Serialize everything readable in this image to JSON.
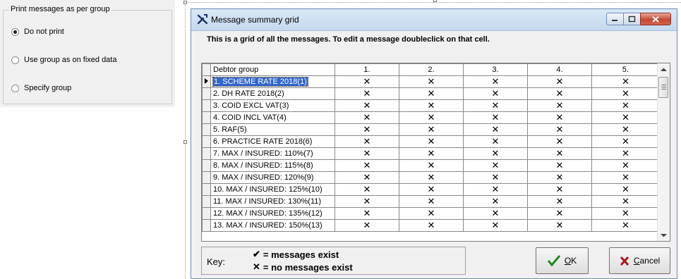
{
  "group_box": {
    "legend": "Print messages as per group",
    "options": [
      {
        "label": "Do not print",
        "checked": true
      },
      {
        "label": "Use group as on fixed data",
        "checked": false
      },
      {
        "label": "Specify group",
        "checked": false
      }
    ]
  },
  "dialog": {
    "title": "Message summary grid",
    "instruction": "This is a grid of all the messages.  To edit a message doubleclick on that cell.",
    "grid": {
      "header_first": "Debtor group",
      "columns": [
        "1.",
        "2.",
        "3.",
        "4.",
        "5."
      ],
      "no_message_symbol": "✕",
      "rows": [
        "1. SCHEME RATE 2018(1)",
        "2. DH RATE 2018(2)",
        "3. COID EXCL VAT(3)",
        "4. COID INCL VAT(4)",
        "5. RAF(5)",
        "6. PRACTICE RATE 2018(6)",
        "7. MAX / INSURED: 110%(7)",
        "8. MAX / INSURED: 115%(8)",
        "9. MAX / INSURED: 120%(9)",
        "10. MAX / INSURED: 125%(10)",
        "11. MAX / INSURED: 130%(11)",
        "12. MAX / INSURED: 135%(12)",
        "13. MAX / INSURED: 150%(13)"
      ],
      "selected_row": 0
    },
    "key": {
      "label": "Key:",
      "exists_symbol": "✔",
      "exists_text": "= messages exist",
      "none_symbol": "✕",
      "none_text": "= no messages exist"
    },
    "ok_button": {
      "accel": "O",
      "rest": "K"
    },
    "cancel_button": {
      "accel": "C",
      "rest": "ancel"
    },
    "colors": {
      "ok_check": "#1f8a1f",
      "cancel_x": "#b01515",
      "selection": "#3366cc"
    }
  }
}
